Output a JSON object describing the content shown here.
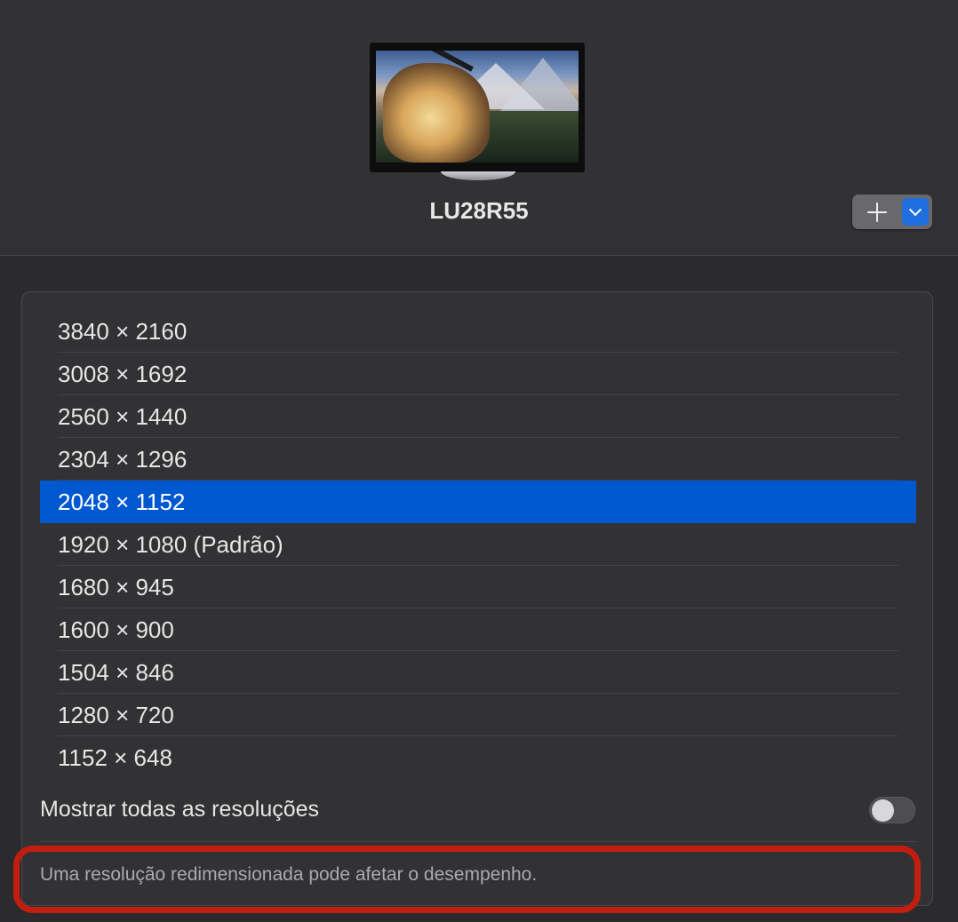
{
  "display": {
    "name": "LU28R55"
  },
  "controls": {
    "add_icon": "plus-icon",
    "menu_icon": "chevron-down-icon",
    "accent": "#1f6fe0"
  },
  "resolutions": {
    "items": [
      {
        "label": "3840 × 2160"
      },
      {
        "label": "3008 × 1692"
      },
      {
        "label": "2560 × 1440"
      },
      {
        "label": "2304 × 1296"
      },
      {
        "label": "2048 × 1152"
      },
      {
        "label": "1920 × 1080 (Padrão)"
      },
      {
        "label": "1680 × 945"
      },
      {
        "label": "1600 × 900"
      },
      {
        "label": "1504 × 846"
      },
      {
        "label": "1280 × 720"
      },
      {
        "label": "1152 × 648"
      }
    ],
    "selected_index": 4,
    "selected_color": "#0058d0"
  },
  "show_all": {
    "label": "Mostrar todas as resoluções",
    "enabled": false
  },
  "notice": {
    "text": "Uma resolução redimensionada pode afetar o desempenho.",
    "highlight_color": "#c21e0f"
  }
}
